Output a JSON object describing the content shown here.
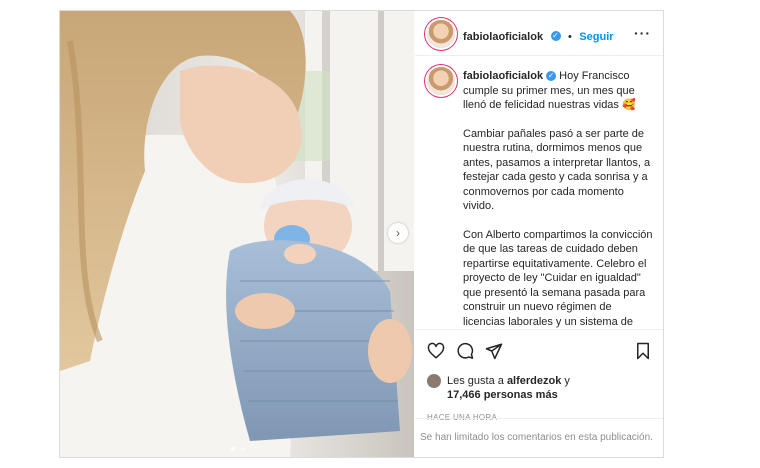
{
  "header": {
    "username": "fabiolaoficialok",
    "follow_label": "Seguir",
    "more_icon": "more-horizontal-icon"
  },
  "caption": {
    "username": "fabiolaoficialok",
    "para1": "Hoy Francisco cumple su primer mes, un mes que llenó de felicidad nuestras vidas 🥰",
    "para2": "Cambiar pañales pasó a ser parte de nuestra rutina, dormimos menos que antes, pasamos a interpretar llantos, a festejar cada gesto y cada sonrisa y a conmovernos por cada momento vivido.",
    "para3": "Con Alberto compartimos la convicción de que las tareas de cuidado deben repartirse equitativamente. Celebro el proyecto de ley \"Cuidar en igualdad\" que presentó la semana pasada para construir un nuevo régimen de licencias laborales y un sistema de cuidados integral."
  },
  "likes": {
    "prefix": "Les gusta a",
    "user": "alferdezok",
    "connector": "y",
    "count": "17,466 personas más"
  },
  "timestamp": "HACE UNA HORA",
  "comments_disabled": "Se han limitado los comentarios en esta publicación.",
  "colors": {
    "link": "#0095f6",
    "verified": "#3897f0",
    "border": "#dbdbdb"
  },
  "carousel": {
    "total": 2,
    "current": 1
  }
}
